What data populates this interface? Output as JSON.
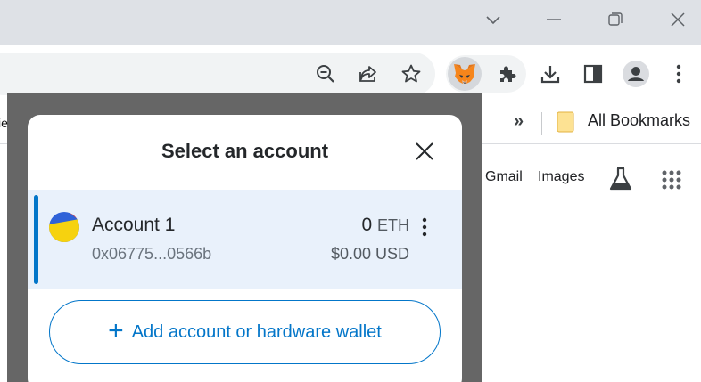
{
  "bookmarks": {
    "all_bookmarks_label": "All Bookmarks"
  },
  "page": {
    "gmail_label": "Gmail",
    "images_label": "Images"
  },
  "popup": {
    "edge_text": "ie"
  },
  "modal": {
    "title": "Select an account",
    "account": {
      "name": "Account 1",
      "address": "0x06775...0566b",
      "balance": "0",
      "balance_unit": "ETH",
      "fiat_value": "$0.00 USD"
    },
    "add_button_label": "Add account or hardware wallet"
  },
  "icons": {
    "window": [
      "chevron-down-icon",
      "minimize-icon",
      "restore-icon",
      "close-window-icon"
    ],
    "toolbar": [
      "zoom-out-icon",
      "share-icon",
      "star-icon",
      "metamask-fox-icon",
      "puzzle-icon",
      "download-icon",
      "side-panel-icon",
      "profile-icon",
      "more-vert-icon"
    ]
  },
  "colors": {
    "accent": "#0376c9",
    "selected_row_bg": "#e9f1fb",
    "overlay": "#666666",
    "titlebar": "#dee1e6"
  }
}
